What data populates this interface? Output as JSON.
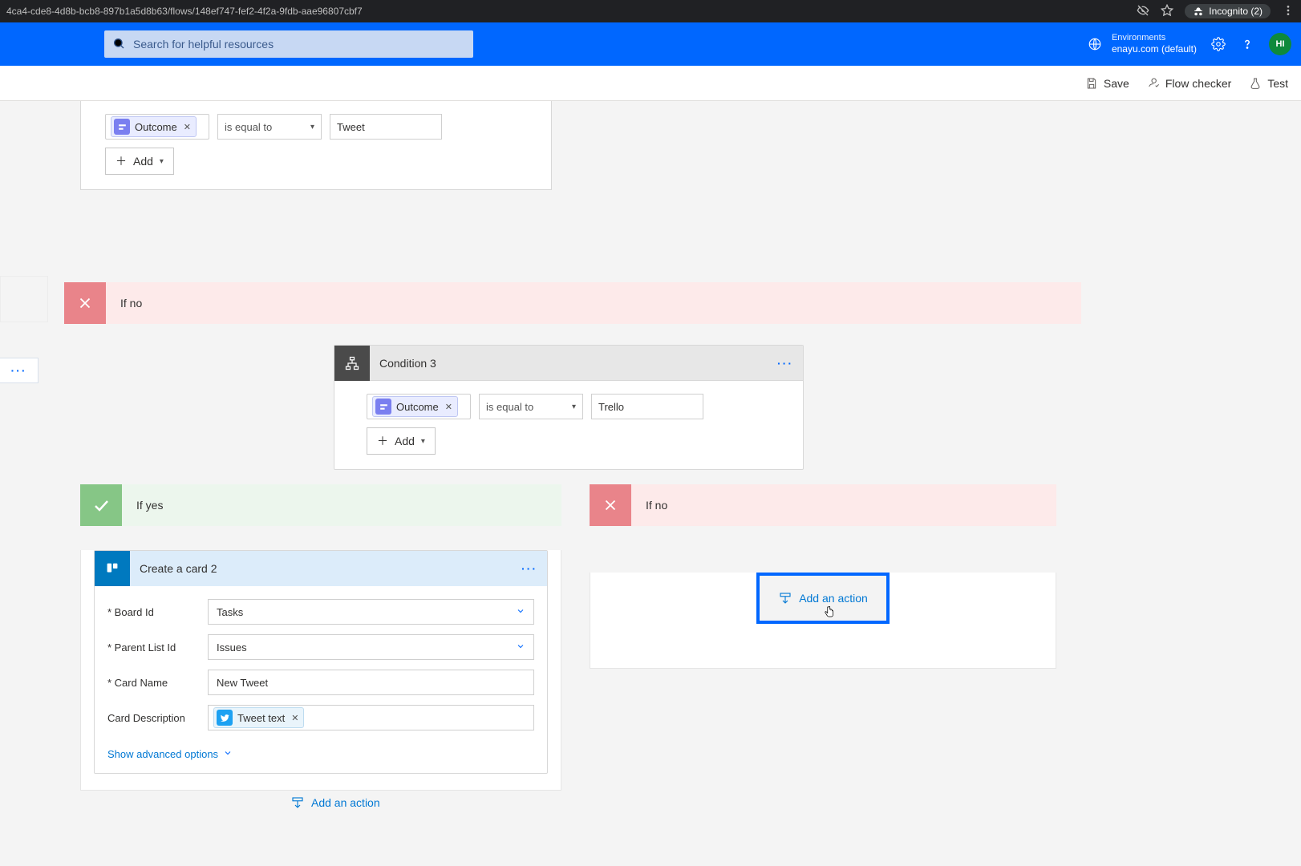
{
  "browser": {
    "url": "4ca4-cde8-4d8b-bcb8-897b1a5d8b63/flows/148ef747-fef2-4f2a-9fdb-aae96807cbf7",
    "incognito_label": "Incognito (2)"
  },
  "header": {
    "search_placeholder": "Search for helpful resources",
    "environments_label": "Environments",
    "environment_value": "enayu.com (default)",
    "avatar_initials": "HI"
  },
  "command_bar": {
    "save": "Save",
    "flow_checker": "Flow checker",
    "test": "Test"
  },
  "condition_top": {
    "token_label": "Outcome",
    "operator": "is equal to",
    "value": "Tweet",
    "add_label": "Add"
  },
  "branch_labels": {
    "if_no": "If no",
    "if_yes": "If yes"
  },
  "condition3": {
    "title": "Condition 3",
    "token_label": "Outcome",
    "operator": "is equal to",
    "value": "Trello",
    "add_label": "Add"
  },
  "trello_card": {
    "title": "Create a card 2",
    "fields": {
      "board_id_label": "* Board Id",
      "board_id_value": "Tasks",
      "parent_list_label": "* Parent List Id",
      "parent_list_value": "Issues",
      "card_name_label": "* Card Name",
      "card_name_value": "New Tweet",
      "card_desc_label": "Card Description",
      "card_desc_token": "Tweet text"
    },
    "advanced_label": "Show advanced options"
  },
  "add_action_label": "Add an action",
  "ellipsis": "···"
}
